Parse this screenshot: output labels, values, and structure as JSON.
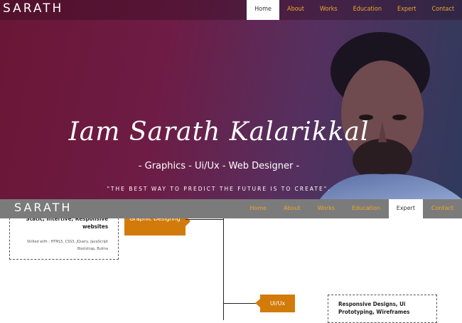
{
  "site": {
    "logo": "SARATH"
  },
  "nav": {
    "items": [
      "Home",
      "About",
      "Works",
      "Education",
      "Expert",
      "Contact"
    ],
    "active": "Home"
  },
  "hero": {
    "name": "Iam Sarath Kalarikkal",
    "role": "- Graphics - Ui/Ux - Web Designer -",
    "quote": "\"THE BEST WAY TO PREDICT THE FUTURE IS TO CREATE\"."
  },
  "sticky_nav": {
    "logo": "SARATH",
    "items": [
      "Home",
      "About",
      "Works",
      "Education",
      "Expert",
      "Contact"
    ],
    "active": "Expert"
  },
  "expert": {
    "card1": {
      "title": "Static, Intertive, Responsive websites",
      "description": "Shilled with : HTML5, CSS3, JQuery, JavaScript Bootstrap, Bulma"
    },
    "tag1": "Graphic Designng",
    "tag2": "Ui/Ux",
    "card2": {
      "title": "Responsive Designs, Ui Prototyping, Wireframes"
    }
  },
  "colors": {
    "accent": "#f0a62a",
    "tag": "#d27a0a",
    "hero_left": "#6a1636",
    "hero_right": "#2f3a5c",
    "sticky_bar": "#7b7b7b"
  }
}
